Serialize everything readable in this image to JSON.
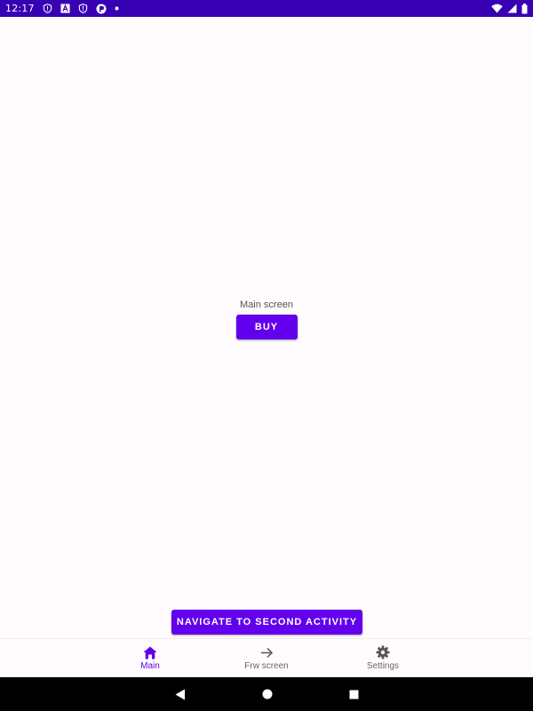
{
  "status_bar": {
    "time": "12:17",
    "left_icons": [
      "shield-alert-icon",
      "font-a-icon",
      "shield-alert-icon",
      "app-badge-icon",
      "dot-icon"
    ],
    "right_icons": [
      "wifi-icon",
      "signal-icon",
      "battery-icon"
    ],
    "background": "#3700b3"
  },
  "main": {
    "label": "Main screen",
    "buy_label": "BUY",
    "navigate_label": "NAVIGATE TO SECOND ACTIVITY"
  },
  "bottom_nav": {
    "items": [
      {
        "label": "Main",
        "icon": "home-icon",
        "active": true
      },
      {
        "label": "Frw screen",
        "icon": "arrow-right-icon",
        "active": false
      },
      {
        "label": "Settings",
        "icon": "gear-icon",
        "active": false
      }
    ]
  },
  "system_nav": {
    "icons": [
      "back-icon",
      "home-circle-icon",
      "recents-icon"
    ]
  },
  "colors": {
    "accent": "#6200ee",
    "status_bar": "#3700b3",
    "background": "#fffbfe"
  }
}
